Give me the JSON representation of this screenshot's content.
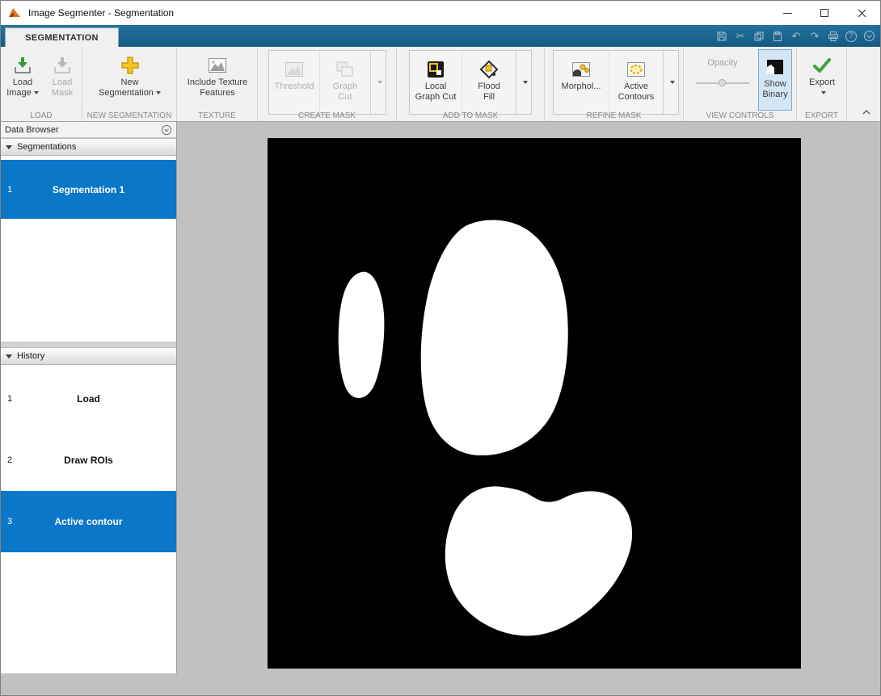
{
  "titlebar": {
    "title": "Image Segmenter - Segmentation"
  },
  "tabbar": {
    "segmentation_tab": "SEGMENTATION"
  },
  "icons": {
    "help_glyph": "?",
    "cut_glyph": "✂",
    "undo_glyph": "↶",
    "redo_glyph": "↷"
  },
  "colors": {
    "selection_blue": "#0a77c9",
    "tabstrip_blue": "#1b648f",
    "canvas_black": "#000000",
    "mask_white": "#ffffff"
  },
  "ribbon": {
    "load": {
      "label": "LOAD",
      "load_image_l1": "Load",
      "load_image_l2": "Image",
      "load_mask_l1": "Load",
      "load_mask_l2": "Mask"
    },
    "new_segmentation": {
      "label": "NEW SEGMENTATION",
      "l1": "New",
      "l2": "Segmentation"
    },
    "texture": {
      "label": "TEXTURE",
      "l1": "Include Texture",
      "l2": "Features"
    },
    "create_mask": {
      "label": "CREATE MASK",
      "threshold": "Threshold",
      "graph_cut_l1": "Graph",
      "graph_cut_l2": "Cut"
    },
    "add_to_mask": {
      "label": "ADD TO MASK",
      "local_l1": "Local",
      "local_l2": "Graph Cut",
      "flood_l1": "Flood",
      "flood_l2": "Fill"
    },
    "refine_mask": {
      "label": "REFINE MASK",
      "morphology": "Morphol...",
      "active_l1": "Active",
      "active_l2": "Contours"
    },
    "view_controls": {
      "label": "VIEW CONTROLS",
      "opacity": "Opacity",
      "show_l1": "Show",
      "show_l2": "Binary"
    },
    "export": {
      "label": "EXPORT",
      "l1": "Export"
    }
  },
  "data_browser": {
    "title": "Data Browser",
    "segmentations": {
      "header": "Segmentations",
      "rows": [
        {
          "num": "1",
          "label": "Segmentation 1"
        }
      ]
    },
    "history": {
      "header": "History",
      "rows": [
        {
          "num": "1",
          "label": "Load"
        },
        {
          "num": "2",
          "label": "Draw ROIs"
        },
        {
          "num": "3",
          "label": "Active contour"
        }
      ]
    }
  }
}
